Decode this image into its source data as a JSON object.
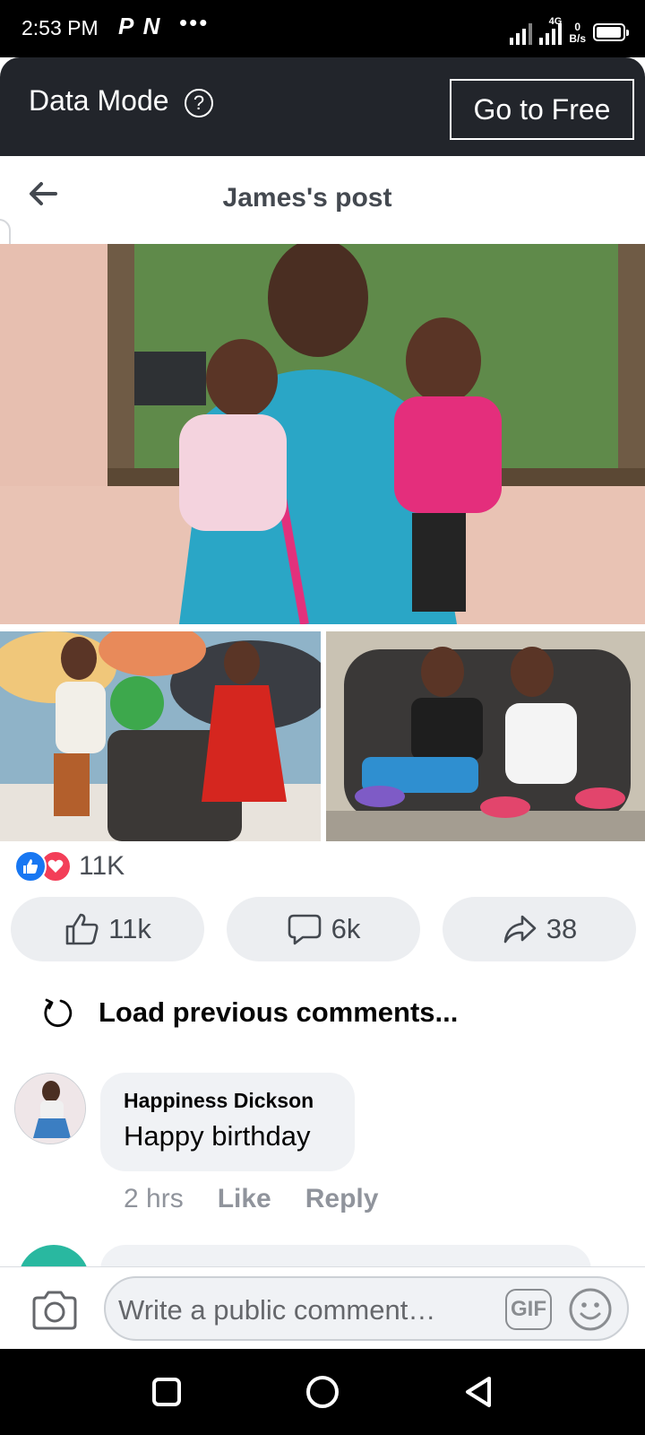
{
  "status_bar": {
    "time": "2:53 PM",
    "notification_icons": "P N",
    "more": "•••",
    "network_label": "4G",
    "speed_value": "0",
    "speed_unit": "B/s",
    "battery_level": 0.95
  },
  "data_mode": {
    "label": "Data Mode",
    "help_icon": "?",
    "go_free_label": "Go to Free"
  },
  "header": {
    "title": "James's post",
    "back_icon": "arrow-left-icon"
  },
  "reactions": {
    "icons": [
      "like-icon",
      "love-icon"
    ],
    "count": "11K"
  },
  "actions": {
    "like_count": "11k",
    "comment_count": "6k",
    "share_count": "38"
  },
  "comments": {
    "load_previous": "Load previous comments...",
    "items": [
      {
        "author": "Happiness Dickson",
        "text": "Happy birthday",
        "time": "2 hrs",
        "like_label": "Like",
        "reply_label": "Reply"
      }
    ]
  },
  "composer": {
    "placeholder": "Write a public comment…",
    "gif_label": "GIF"
  },
  "colors": {
    "data_mode_bg": "#22252b",
    "like_blue": "#1877f2",
    "love_red": "#f33e58",
    "pill_bg": "#eceef1"
  }
}
